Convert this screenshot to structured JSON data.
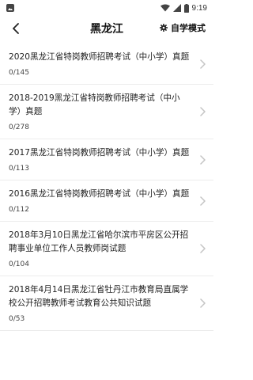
{
  "status": {
    "time": "9:19"
  },
  "header": {
    "title": "黑龙江",
    "mode_label": "自学模式"
  },
  "exams": [
    {
      "title": "2020黑龙江省特岗教师招聘考试（中小学）真题",
      "progress": "0/145"
    },
    {
      "title": "2018-2019黑龙江省特岗教师招聘考试（中小学）真题",
      "progress": "0/278"
    },
    {
      "title": "2017黑龙江省特岗教师招聘考试（中小学）真题",
      "progress": "0/113"
    },
    {
      "title": "2016黑龙江省特岗教师招聘考试（中小学）真题",
      "progress": "0/112"
    },
    {
      "title": "2018年3月10日黑龙江省哈尔滨市平房区公开招聘事业单位工作人员教师岗试题",
      "progress": "0/104"
    },
    {
      "title": "2018年4月14日黑龙江省牡丹江市教育局直属学校公开招聘教师考试教育公共知识试题",
      "progress": "0/53"
    }
  ]
}
